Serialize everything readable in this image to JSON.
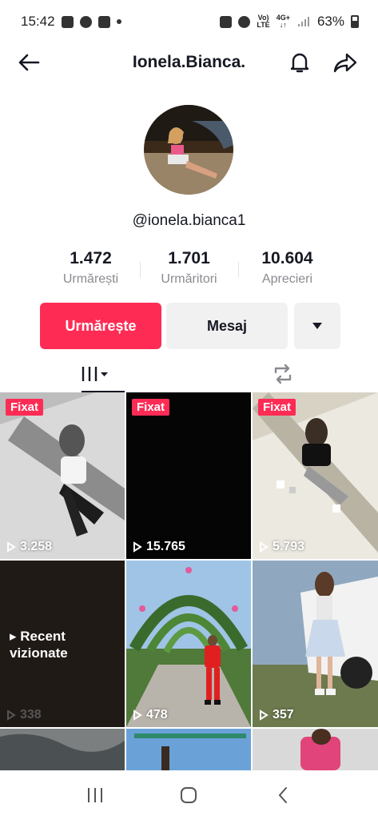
{
  "status_bar": {
    "time": "15:42",
    "battery": "63%",
    "net_top": "Vo)",
    "net_bottom": "LTE",
    "gen_top": "4G+"
  },
  "header": {
    "title": "Ionela.Bianca."
  },
  "profile": {
    "handle": "@ionela.bianca1"
  },
  "stats": [
    {
      "value": "1.472",
      "label": "Urmărești"
    },
    {
      "value": "1.701",
      "label": "Urmăritori"
    },
    {
      "value": "10.604",
      "label": "Aprecieri"
    }
  ],
  "actions": {
    "follow": "Urmărește",
    "message": "Mesaj"
  },
  "videos": [
    {
      "pinned": "Fixat",
      "views": "3.258"
    },
    {
      "pinned": "Fixat",
      "views": "15.765"
    },
    {
      "pinned": "Fixat",
      "views": "5.793"
    },
    {
      "overlay": "Recent vizionate",
      "views": "338"
    },
    {
      "views": "478"
    },
    {
      "views": "357"
    }
  ],
  "colors": {
    "accent": "#fe2c55",
    "text": "#161823",
    "muted": "#8a8b91"
  }
}
